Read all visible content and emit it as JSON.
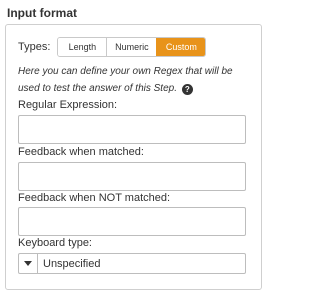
{
  "section": {
    "title": "Input format"
  },
  "types": {
    "label": "Types:",
    "options": [
      "Length",
      "Numeric",
      "Custom"
    ],
    "selected": "Custom"
  },
  "help": {
    "text": "Here you can define your own Regex that will be used to test the answer of this Step.",
    "icon": "question-circle-icon"
  },
  "fields": {
    "regex": {
      "label": "Regular Expression:",
      "value": ""
    },
    "feedback_matched": {
      "label": "Feedback when matched:",
      "value": ""
    },
    "feedback_not_matched": {
      "label": "Feedback when NOT matched:",
      "value": ""
    }
  },
  "keyboard": {
    "label": "Keyboard type:",
    "selected": "Unspecified"
  },
  "colors": {
    "accent": "#e8931a",
    "border": "#cfcfcf",
    "text": "#333333"
  }
}
